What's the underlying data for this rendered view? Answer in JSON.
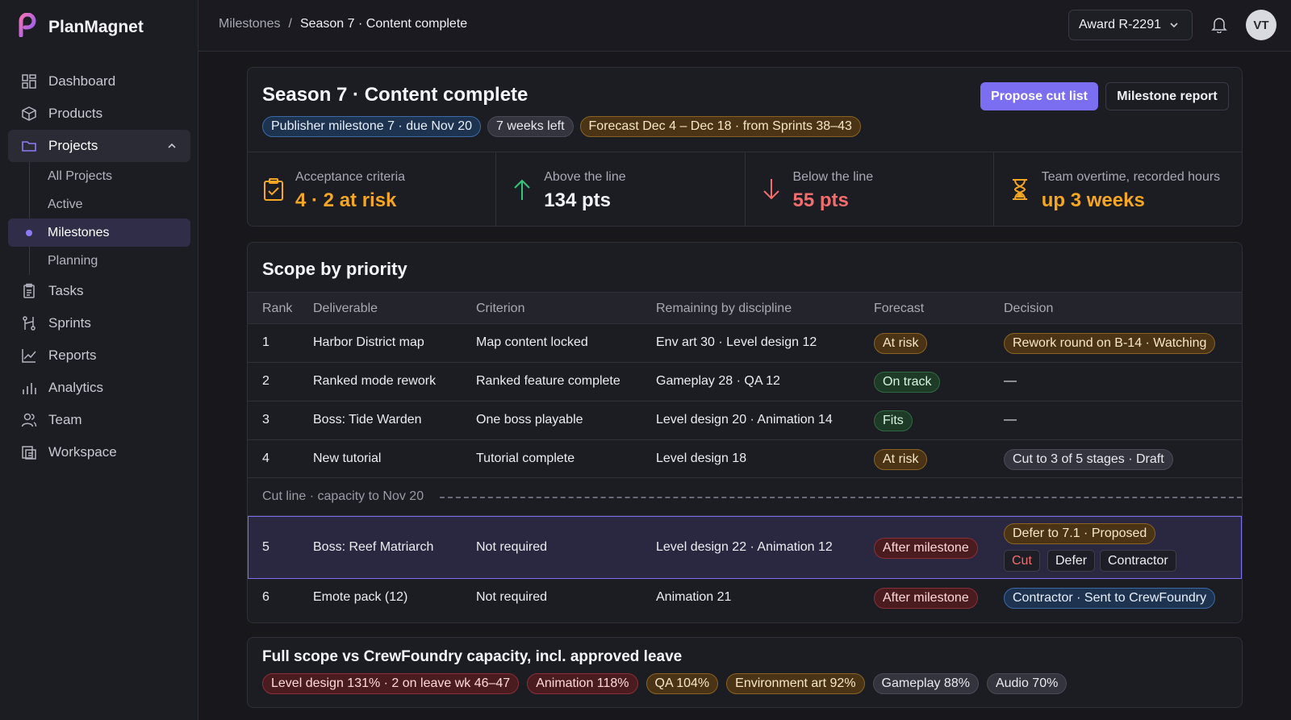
{
  "app": {
    "name": "PlanMagnet"
  },
  "nav": {
    "items": [
      {
        "label": "Dashboard",
        "icon": "dashboard-icon"
      },
      {
        "label": "Products",
        "icon": "box-icon"
      },
      {
        "label": "Projects",
        "icon": "folder-icon"
      }
    ],
    "projects_sub": [
      "All Projects",
      "Active",
      "Milestones",
      "Planning"
    ],
    "items_after": [
      {
        "label": "Tasks",
        "icon": "clipboard-icon"
      },
      {
        "label": "Sprints",
        "icon": "sprint-icon"
      },
      {
        "label": "Reports",
        "icon": "line-chart-icon"
      },
      {
        "label": "Analytics",
        "icon": "bar-chart-icon"
      },
      {
        "label": "Team",
        "icon": "users-icon"
      },
      {
        "label": "Workspace",
        "icon": "workspace-icon"
      }
    ]
  },
  "topbar": {
    "breadcrumb_root": "Milestones",
    "breadcrumb_sep": "/",
    "breadcrumb_current": "Season 7 · Content complete",
    "award": "Award R-2291",
    "avatar_initials": "VT"
  },
  "milestone": {
    "title": "Season 7 · Content complete",
    "pills": {
      "publisher": "Publisher milestone 7 · due Nov 20",
      "weeks_left": "7 weeks left",
      "forecast": "Forecast Dec 4 – Dec 18 · from Sprints 38–43"
    },
    "propose_button": "Propose cut list",
    "report_button": "Milestone report",
    "stats": [
      {
        "label": "Acceptance criteria",
        "value": "4 · 2 at risk"
      },
      {
        "label": "Above the line",
        "value": "134 pts"
      },
      {
        "label": "Below the line",
        "value": "55 pts"
      },
      {
        "label": "Team overtime, recorded hours",
        "value": "up 3 weeks"
      }
    ]
  },
  "scope": {
    "title": "Scope by priority",
    "columns": [
      "Rank",
      "Deliverable",
      "Criterion",
      "Remaining by discipline",
      "Forecast",
      "Decision"
    ],
    "rows": [
      {
        "rank": "1",
        "deliverable": "Harbor District map",
        "criterion": "Map content locked",
        "remaining": "Env art 30 · Level design 12",
        "forecast": "At risk",
        "decision": "Rework round on B-14 · Watching"
      },
      {
        "rank": "2",
        "deliverable": "Ranked mode rework",
        "criterion": "Ranked feature complete",
        "remaining": "Gameplay 28 · QA 12",
        "forecast": "On track",
        "decision": "—"
      },
      {
        "rank": "3",
        "deliverable": "Boss: Tide Warden",
        "criterion": "One boss playable",
        "remaining": "Level design 20 · Animation 14",
        "forecast": "Fits",
        "decision": "—"
      },
      {
        "rank": "4",
        "deliverable": "New tutorial",
        "criterion": "Tutorial complete",
        "remaining": "Level design 18",
        "forecast": "At risk",
        "decision": "Cut to 3 of 5 stages · Draft"
      },
      {
        "rank": "5",
        "deliverable": "Boss: Reef Matriarch",
        "criterion": "Not required",
        "remaining": "Level design 22 · Animation 12",
        "forecast": "After milestone",
        "decision": "Defer to 7.1 · Proposed"
      },
      {
        "rank": "6",
        "deliverable": "Emote pack (12)",
        "criterion": "Not required",
        "remaining": "Animation 21",
        "forecast": "After milestone",
        "decision": "Contractor · Sent to CrewFoundry"
      }
    ],
    "cut_line": "Cut line · capacity to Nov 20",
    "actions": [
      "Cut",
      "Defer",
      "Contractor"
    ]
  },
  "capacity": {
    "title": "Full scope vs CrewFoundry capacity, incl. approved leave",
    "pills": [
      "Level design 131% · 2 on leave wk 46–47",
      "Animation 118%",
      "QA 104%",
      "Environment art 92%",
      "Gameplay 88%",
      "Audio 70%"
    ]
  },
  "colors": {
    "accent": "#7c6ef0",
    "amber": "#f5a623",
    "red": "#f26d6d",
    "green": "#2f6a40"
  }
}
